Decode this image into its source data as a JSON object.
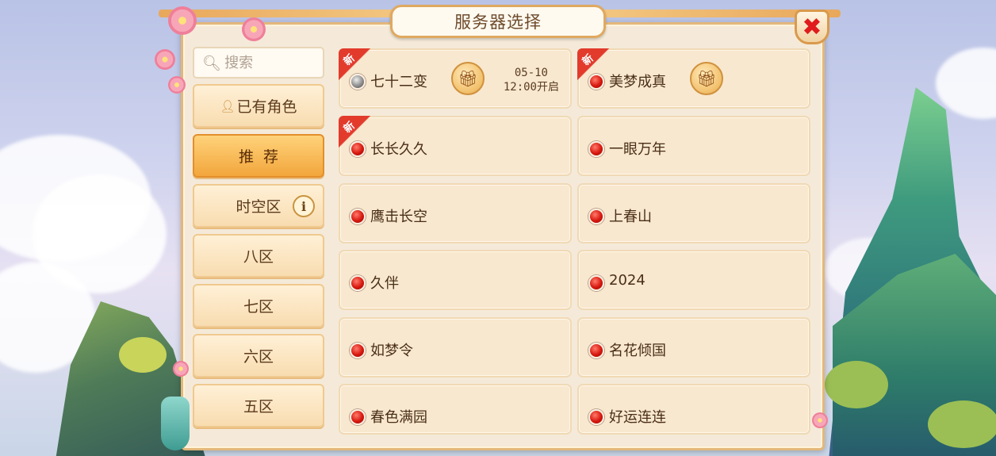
{
  "title": "服务器选择",
  "close_symbol": "✖",
  "search": {
    "placeholder": "搜索",
    "icon": "search-icon"
  },
  "sidebar": {
    "items": [
      {
        "label": "已有角色",
        "icon": "person-icon",
        "active": false
      },
      {
        "label": "推  荐",
        "active": true
      },
      {
        "label": "时空区",
        "info_symbol": "i",
        "active": false
      },
      {
        "label": "八区",
        "active": false
      },
      {
        "label": "七区",
        "active": false
      },
      {
        "label": "六区",
        "active": false
      },
      {
        "label": "五区",
        "active": false
      }
    ]
  },
  "servers": [
    {
      "name": "七十二变",
      "status": "gray",
      "new": true,
      "new_label": "新",
      "gift": true,
      "open_date": "05-10",
      "open_time": "12:00开启"
    },
    {
      "name": "美梦成真",
      "status": "red",
      "new": true,
      "new_label": "新",
      "gift": true
    },
    {
      "name": "长长久久",
      "status": "red",
      "new": true,
      "new_label": "新"
    },
    {
      "name": "一眼万年",
      "status": "red"
    },
    {
      "name": "鹰击长空",
      "status": "red"
    },
    {
      "name": "上春山",
      "status": "red"
    },
    {
      "name": "久伴",
      "status": "red"
    },
    {
      "name": "2024",
      "status": "red"
    },
    {
      "name": "如梦令",
      "status": "red"
    },
    {
      "name": "名花倾国",
      "status": "red"
    },
    {
      "name": "春色满园",
      "status": "red"
    },
    {
      "name": "好运连连",
      "status": "red"
    }
  ],
  "colors": {
    "status_red": "#d8180f",
    "status_gray": "#8d8d8d",
    "active_tab": "#f2a63c",
    "close_x": "#e01c1c"
  }
}
